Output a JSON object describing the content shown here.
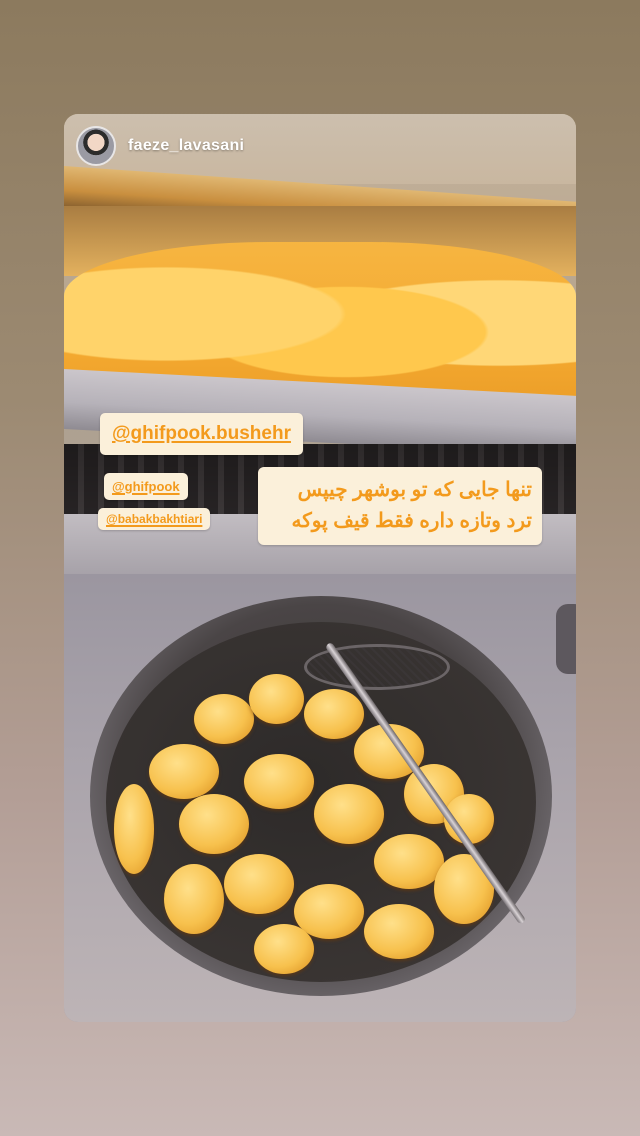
{
  "story": {
    "username": "faeze_lavasani"
  },
  "stickers": {
    "main_mention": "@ghifpook.bushehr",
    "mention_2": "@ghifpook",
    "mention_3": "@babakbakhtiari",
    "caption": "تنها جایی که تو بوشهر چیپس ترد وتازه داره  فقط قیف پوکه"
  },
  "colors": {
    "sticker_bg": "#fbf0da",
    "sticker_text": "#f39a1c"
  }
}
